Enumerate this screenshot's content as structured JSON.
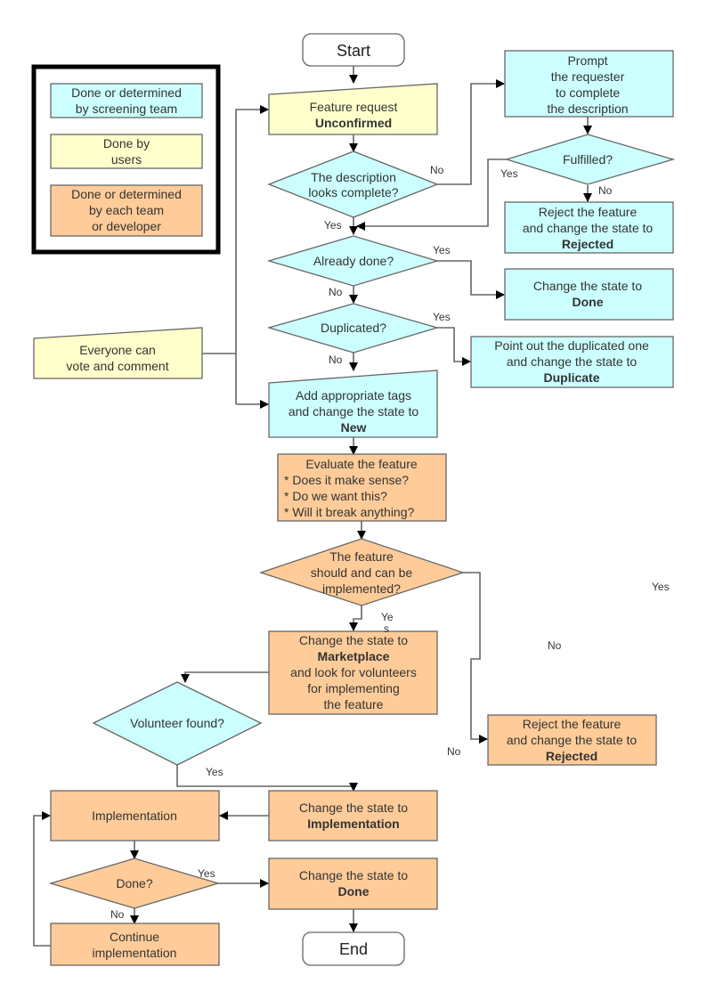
{
  "colors": {
    "screening_team": "#ccffff",
    "users": "#ffffcc",
    "each_team": "#ffcc99",
    "line": "#666666"
  },
  "legend": {
    "items": [
      {
        "lines": [
          "Done or determined",
          "by screening team"
        ],
        "color": "cyan"
      },
      {
        "lines": [
          "Done by",
          "users"
        ],
        "color": "yellow"
      },
      {
        "lines": [
          "Done or determined",
          "by each team",
          "or developer"
        ],
        "color": "orange"
      }
    ]
  },
  "nodes": {
    "start": {
      "label": "Start"
    },
    "feature_request": {
      "line1": "Feature request",
      "state": "Unconfirmed"
    },
    "desc_complete": {
      "lines": [
        "The description",
        "looks complete?"
      ]
    },
    "prompt": {
      "lines": [
        "Prompt",
        "the requester",
        "to complete",
        "the description"
      ]
    },
    "fulfilled": {
      "label": "Fulfilled?"
    },
    "reject_screen": {
      "lines": [
        "Reject the feature",
        "and change the state to"
      ],
      "state": "Rejected"
    },
    "already_done": {
      "label": "Already done?"
    },
    "change_done_screen": {
      "lines": [
        "Change the state to"
      ],
      "state": "Done"
    },
    "duplicated": {
      "label": "Duplicated?"
    },
    "point_duplicate": {
      "lines": [
        "Point out the duplicated one",
        "and change the state to"
      ],
      "state": "Duplicate"
    },
    "everyone_vote": {
      "lines": [
        "Everyone can",
        "vote and comment"
      ]
    },
    "add_tags": {
      "lines": [
        "Add appropriate tags",
        "and change the state to"
      ],
      "state": "New"
    },
    "evaluate": {
      "lines": [
        "Evaluate the feature",
        "* Does it make sense?",
        "* Do we want this?",
        "* Will it break anything?"
      ]
    },
    "should_implement": {
      "lines": [
        "The feature",
        "should and can be",
        "implemented?"
      ]
    },
    "marketplace": {
      "line1": "Change the state to",
      "state": "Marketplace",
      "lines_after": [
        "and look for volunteers",
        "for implementing",
        "the feature"
      ]
    },
    "reject_team": {
      "lines": [
        "Reject the feature",
        "and change the state to"
      ],
      "state": "Rejected"
    },
    "volunteer_found": {
      "label": "Volunteer found?"
    },
    "implementation": {
      "label": "Implementation"
    },
    "change_implementation": {
      "lines": [
        "Change the state to"
      ],
      "state": "Implementation"
    },
    "done_q": {
      "label": "Done?"
    },
    "change_done_team": {
      "lines": [
        "Change the state to"
      ],
      "state": "Done"
    },
    "continue_impl": {
      "lines": [
        "Continue",
        "implementation"
      ]
    },
    "end": {
      "label": "End"
    }
  },
  "edge_labels": {
    "desc_no": "No",
    "desc_yes": "Yes",
    "fulfilled_yes": "Yes",
    "fulfilled_no": "No",
    "already_yes": "Yes",
    "already_no": "No",
    "dup_yes": "Yes",
    "dup_no": "No",
    "should_yes_1": "Ye",
    "should_yes_2": "s",
    "stray_yes": "Yes",
    "stray_no": "No",
    "reject_no": "No",
    "volunteer_yes": "Yes",
    "done_yes": "Yes",
    "done_no": "No"
  }
}
